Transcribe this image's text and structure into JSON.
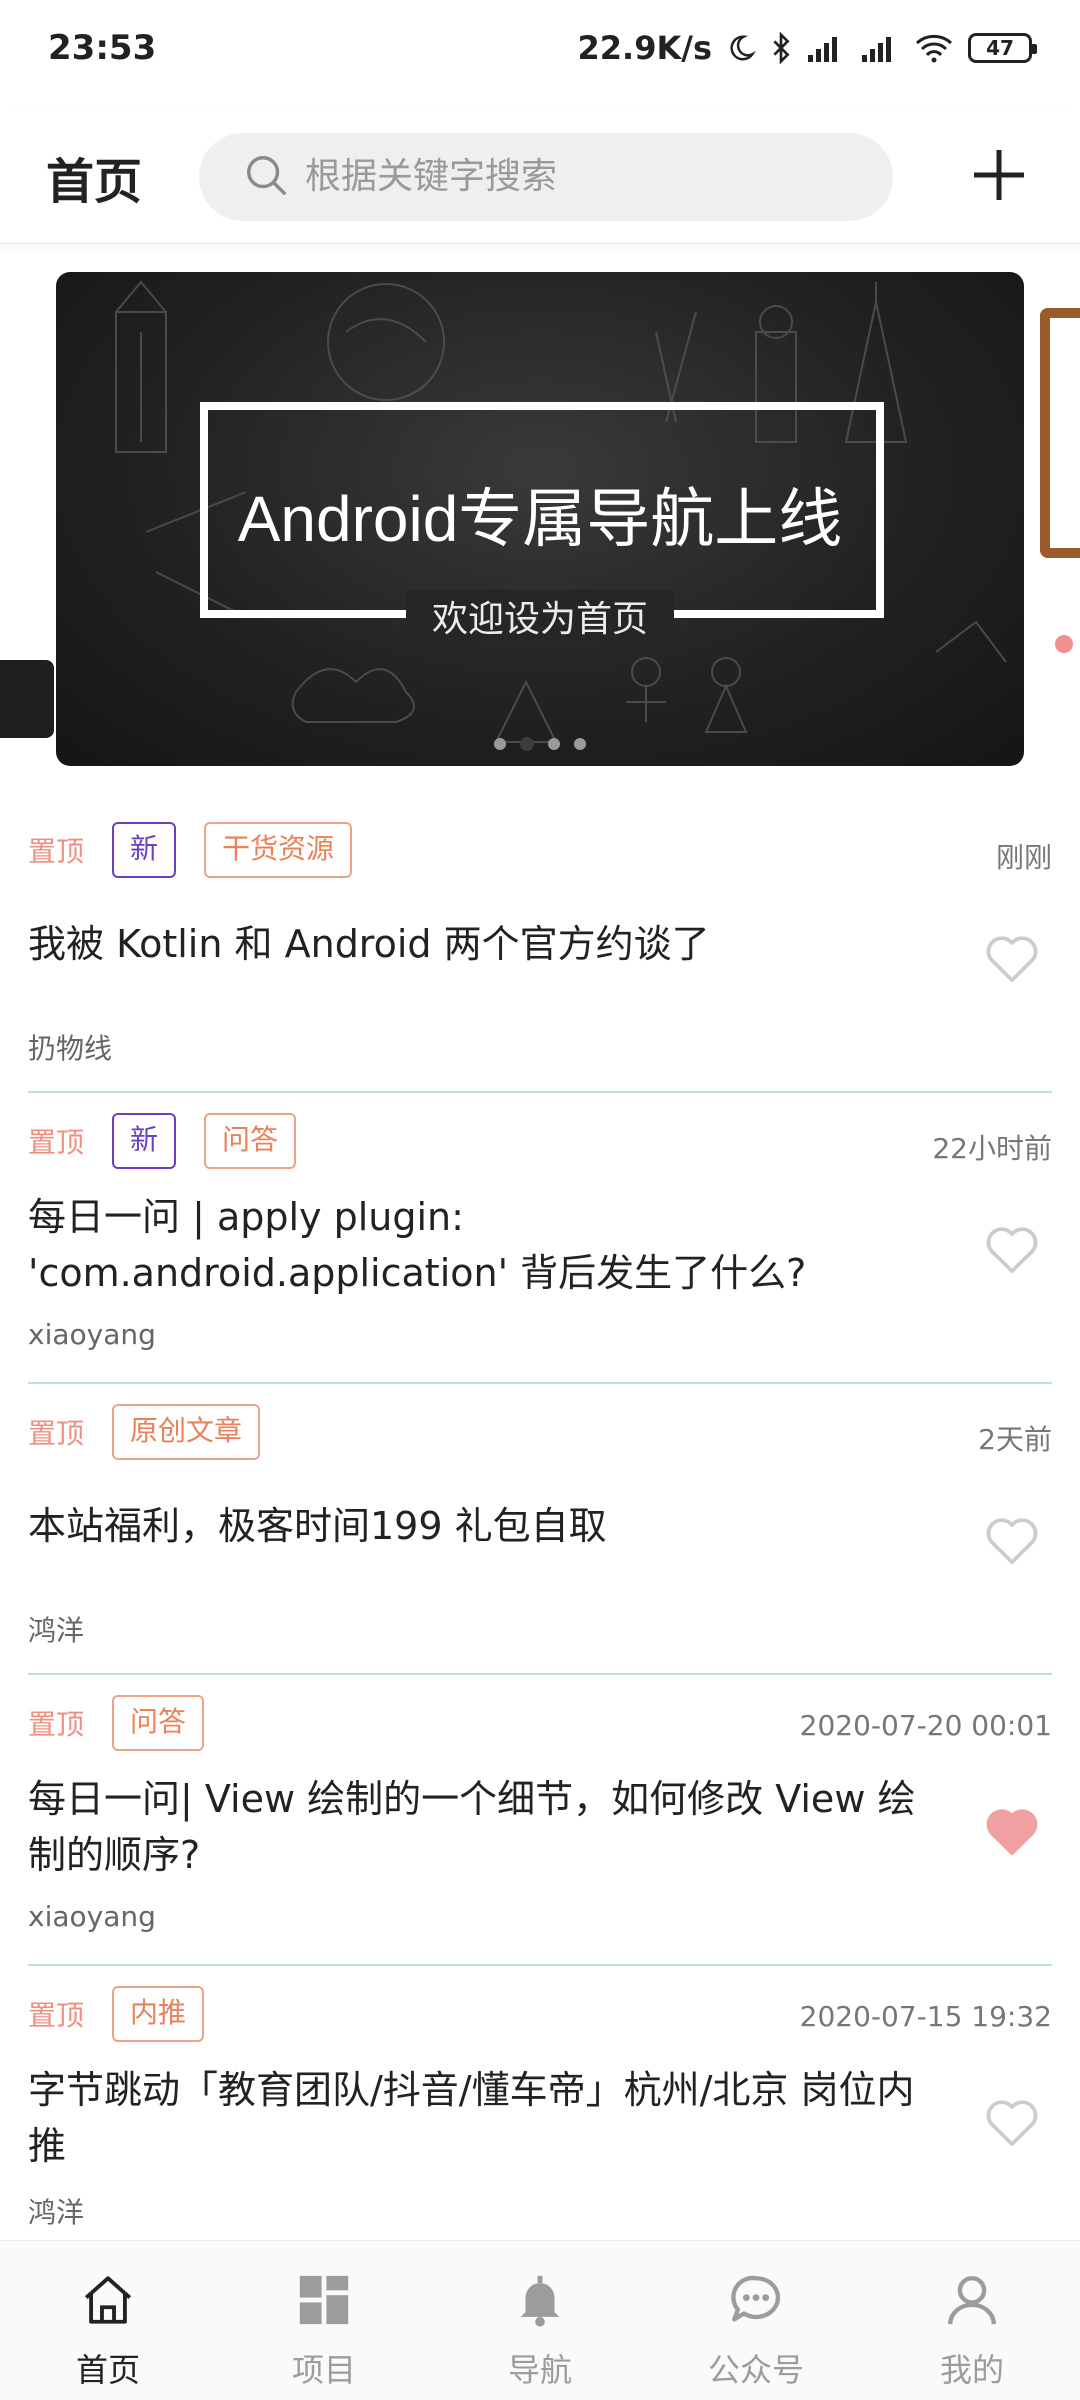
{
  "status_bar": {
    "time": "23:53",
    "network_speed": "22.9K/s",
    "battery": "47",
    "icons": [
      "moon-icon",
      "bluetooth-icon",
      "signal-icon",
      "signal-icon",
      "wifi-icon",
      "battery-icon"
    ]
  },
  "app_bar": {
    "title": "首页",
    "search_placeholder": "根据关键字搜索",
    "add_icon": "plus-icon"
  },
  "banner": {
    "title": "Android专属导航上线",
    "subtitle": "欢迎设为首页",
    "slide_count": 4,
    "active_slide": 1
  },
  "articles": [
    {
      "top_label": "置顶",
      "tags": [
        {
          "text": "新",
          "style": "new"
        },
        {
          "text": "干货资源",
          "style": "orange"
        }
      ],
      "time": "刚刚",
      "title": "我被 Kotlin 和 Android 两个官方约谈了",
      "author": "扔物线",
      "liked": false
    },
    {
      "top_label": "置顶",
      "tags": [
        {
          "text": "新",
          "style": "new"
        },
        {
          "text": "问答",
          "style": "orange"
        }
      ],
      "time": "22小时前",
      "title": "每日一问 | apply plugin: 'com.android.application' 背后发生了什么?",
      "author": "xiaoyang",
      "liked": false
    },
    {
      "top_label": "置顶",
      "tags": [
        {
          "text": "原创文章",
          "style": "orange"
        }
      ],
      "time": "2天前",
      "title": "本站福利，极客时间199 礼包自取",
      "author": "鸿洋",
      "liked": false
    },
    {
      "top_label": "置顶",
      "tags": [
        {
          "text": "问答",
          "style": "orange"
        }
      ],
      "time": "2020-07-20 00:01",
      "title": "每日一问| View 绘制的一个细节，如何修改 View 绘制的顺序?",
      "author": "xiaoyang",
      "liked": true
    },
    {
      "top_label": "置顶",
      "tags": [
        {
          "text": "内推",
          "style": "orange"
        }
      ],
      "time": "2020-07-15 19:32",
      "title": "字节跳动「教育团队/抖音/懂车帝」杭州/北京 岗位内推",
      "author": "鸿洋",
      "liked": false
    }
  ],
  "bottom_nav": {
    "items": [
      {
        "label": "首页",
        "icon": "home-icon",
        "active": true
      },
      {
        "label": "项目",
        "icon": "grid-icon",
        "active": false
      },
      {
        "label": "导航",
        "icon": "bell-icon",
        "active": false
      },
      {
        "label": "公众号",
        "icon": "chat-icon",
        "active": false
      },
      {
        "label": "我的",
        "icon": "person-icon",
        "active": false
      }
    ]
  },
  "colors": {
    "tag_top": "#ef8f80",
    "tag_new": "#6a3fc0",
    "tag_orange": "#e9815a",
    "divider": "#bfe0dc",
    "heart_liked": "#f0a0a0",
    "heart_empty": "#cccccc"
  }
}
